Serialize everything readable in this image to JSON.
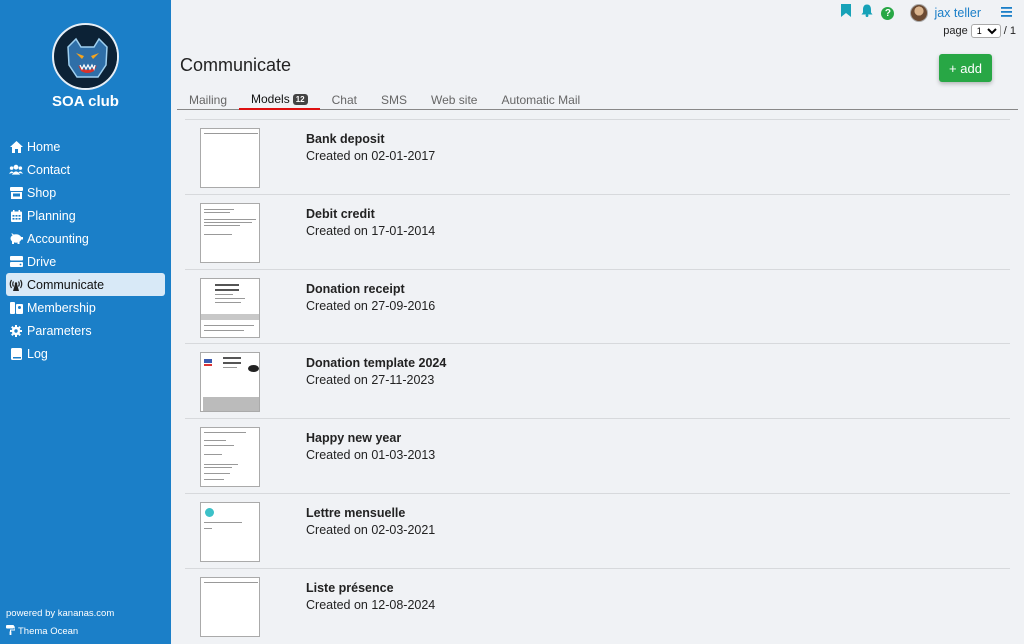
{
  "sidebar": {
    "club_name": "SOA club",
    "items": [
      {
        "label": "Home",
        "icon": "home-icon"
      },
      {
        "label": "Contact",
        "icon": "users-icon"
      },
      {
        "label": "Shop",
        "icon": "shop-icon"
      },
      {
        "label": "Planning",
        "icon": "calendar-icon"
      },
      {
        "label": "Accounting",
        "icon": "piggy-bank-icon"
      },
      {
        "label": "Drive",
        "icon": "hard-drive-icon"
      },
      {
        "label": "Communicate",
        "icon": "broadcast-icon",
        "active": true
      },
      {
        "label": "Membership",
        "icon": "id-card-icon"
      },
      {
        "label": "Parameters",
        "icon": "gear-icon"
      },
      {
        "label": "Log",
        "icon": "book-icon"
      }
    ],
    "powered": "powered by kananas.com",
    "theme": "Thema Ocean"
  },
  "header": {
    "user": "jax teller",
    "page_label": "page",
    "page_current": "1",
    "page_total": "/ 1",
    "title": "Communicate",
    "add_label": "+ add"
  },
  "tabs": [
    {
      "label": "Mailing"
    },
    {
      "label": "Models",
      "badge": "12",
      "active": true
    },
    {
      "label": "Chat"
    },
    {
      "label": "SMS"
    },
    {
      "label": "Web site"
    },
    {
      "label": "Automatic Mail"
    }
  ],
  "models": [
    {
      "name": "Bank deposit",
      "date": "Created on 02-01-2017"
    },
    {
      "name": "Debit credit",
      "date": "Created on 17-01-2014"
    },
    {
      "name": "Donation receipt",
      "date": "Created on 27-09-2016"
    },
    {
      "name": "Donation template 2024",
      "date": "Created on 27-11-2023"
    },
    {
      "name": "Happy new year",
      "date": "Created on 01-03-2013"
    },
    {
      "name": "Lettre mensuelle",
      "date": "Created on 02-03-2021"
    },
    {
      "name": "Liste présence",
      "date": "Created on 12-08-2024"
    }
  ],
  "colors": {
    "sidebar": "#1b7fc8",
    "accent": "#1b7fc8",
    "add_button": "#28a745",
    "active_tab_underline": "#dd1111",
    "help_icon": "#28a745"
  }
}
